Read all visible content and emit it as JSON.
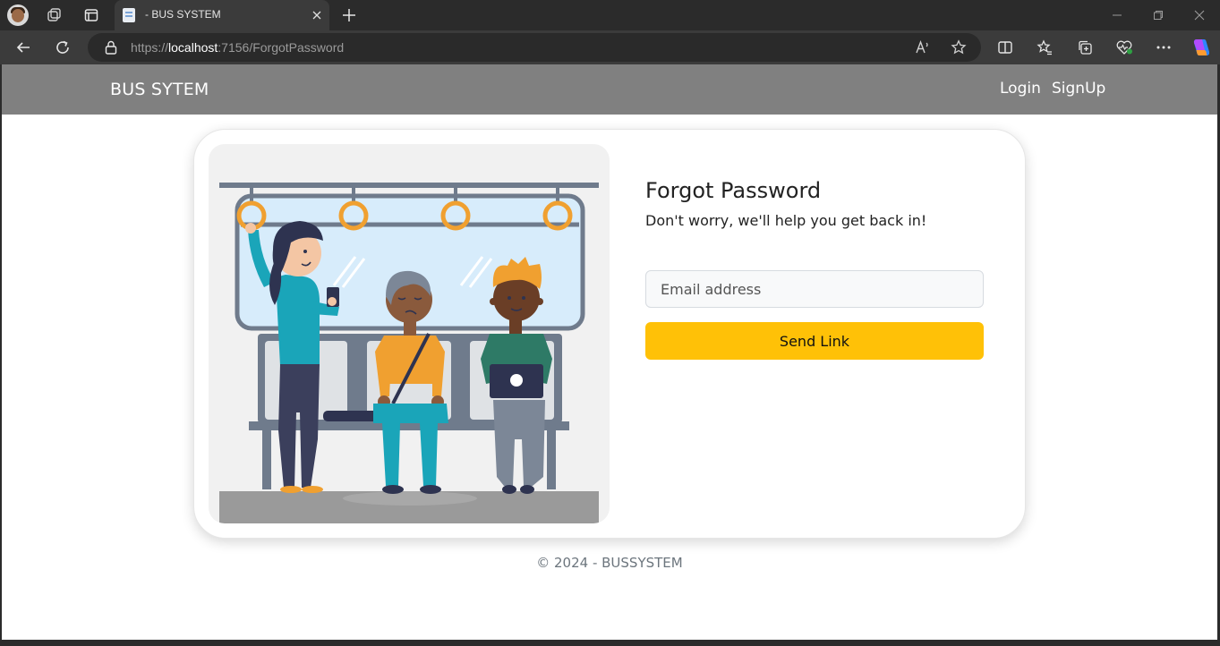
{
  "browser": {
    "tab_title": "- BUS SYSTEM",
    "url_scheme": "https://",
    "url_host": "localhost",
    "url_rest": ":7156/ForgotPassword"
  },
  "navbar": {
    "brand": "BUS SYTEM",
    "links": [
      {
        "label": "Login"
      },
      {
        "label": "SignUp"
      }
    ]
  },
  "forgot_password": {
    "title": "Forgot Password",
    "subtitle": "Don't worry, we'll help you get back in!",
    "email_placeholder": "Email address",
    "email_value": "",
    "submit_label": "Send Link"
  },
  "illustration": {
    "icon": "bus-passengers-illustration"
  },
  "footer": {
    "text": "© 2024 - BUSSYSTEM"
  },
  "colors": {
    "navbar_bg": "#808080",
    "button_accent": "#ffc107",
    "page_bg": "#ffffff"
  }
}
